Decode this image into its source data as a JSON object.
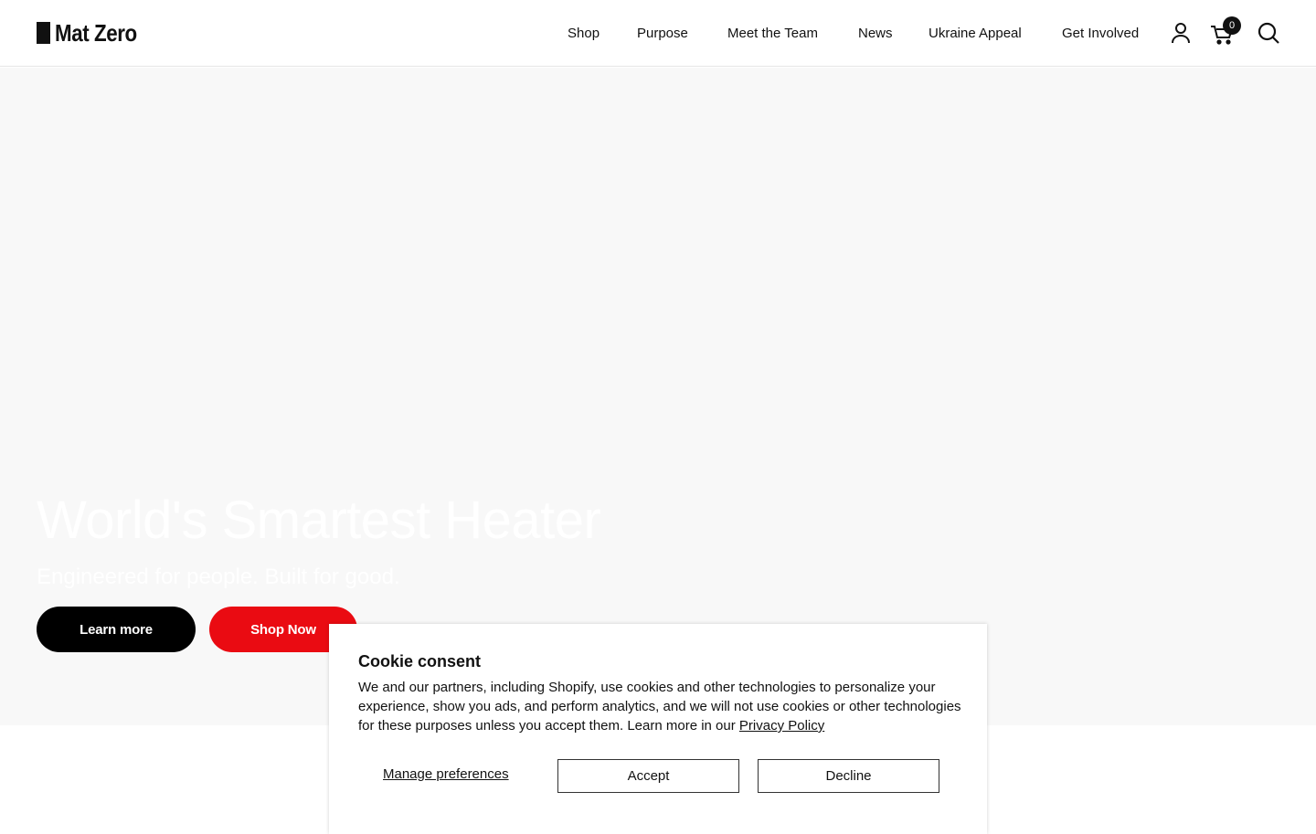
{
  "header": {
    "logo_text": "Mat Zero",
    "nav": [
      {
        "label": "Shop"
      },
      {
        "label": "Purpose"
      },
      {
        "label": "Meet the Team"
      },
      {
        "label": "News"
      },
      {
        "label": "Ukraine Appeal"
      },
      {
        "label": "Get Involved"
      }
    ],
    "icons": {
      "account": "account-icon",
      "cart": "cart-icon",
      "search": "search-icon"
    },
    "cart_count": "0"
  },
  "hero": {
    "title": "World's Smartest Heater",
    "subtitle": "Engineered for people. Built for good.",
    "learn_more_label": "Learn more",
    "shop_now_label": "Shop Now",
    "background_color": "#f8f8f8"
  },
  "cookie": {
    "title": "Cookie consent",
    "body": "We and our partners, including Shopify, use cookies and other technologies to personalize your experience, show you ads, and perform analytics, and we will not use cookies or other technologies for these purposes unless you accept them. Learn more in our",
    "privacy_link": "Privacy Policy",
    "manage_label": "Manage preferences",
    "accept_label": "Accept",
    "decline_label": "Decline"
  },
  "colors": {
    "accent_red": "#ea0b12",
    "dark": "#000000"
  }
}
